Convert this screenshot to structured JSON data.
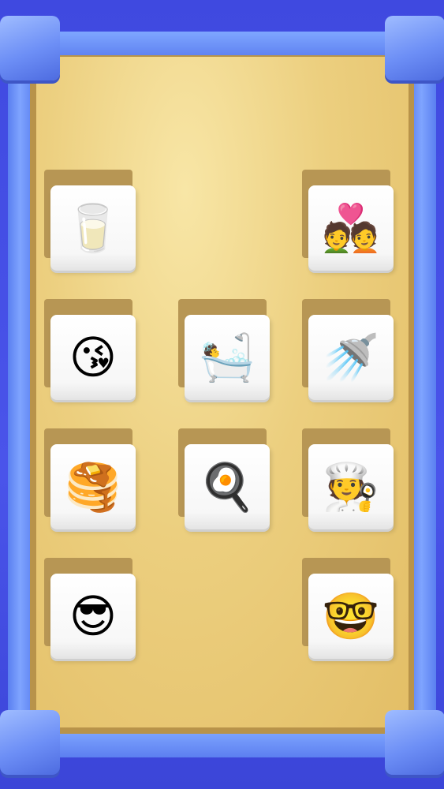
{
  "board": {
    "tiles": [
      {
        "icon": "glass-of-milk",
        "glyph": "🥛"
      },
      {
        "icon": "couple-with-heart",
        "glyph": "💑"
      },
      {
        "icon": "face-blowing-kiss",
        "glyph": "😘"
      },
      {
        "icon": "bathtub",
        "glyph": "🛀"
      },
      {
        "icon": "shower",
        "glyph": "🚿"
      },
      {
        "icon": "pancakes",
        "glyph": "🥞"
      },
      {
        "icon": "frying-pan-egg",
        "glyph": "🍳"
      },
      {
        "icon": "cook",
        "glyph": "🧑‍🍳"
      },
      {
        "icon": "smiling-face-with-sunglasses",
        "glyph": "😎"
      },
      {
        "icon": "nerd-face",
        "glyph": "🤓"
      }
    ]
  },
  "colors": {
    "frame": "#5a7ff0",
    "board": "#eccf7f",
    "tile": "#ffffff"
  }
}
